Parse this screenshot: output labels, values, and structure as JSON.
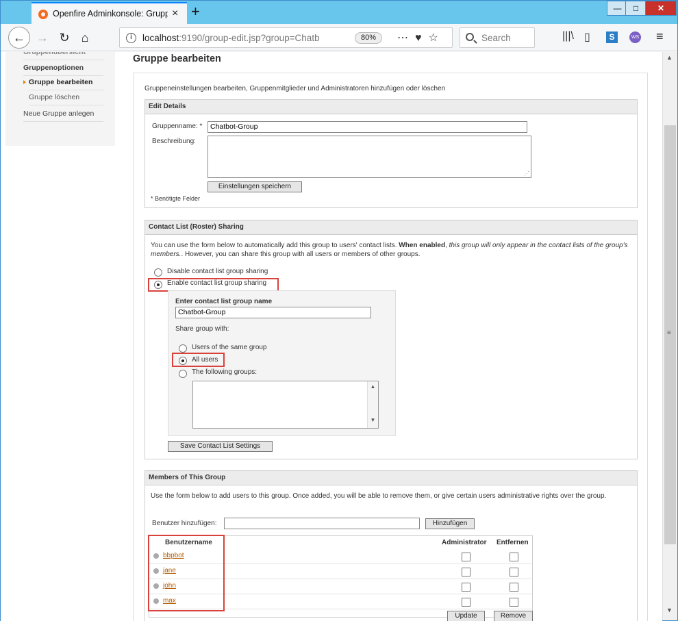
{
  "browser": {
    "tab_title": "Openfire Adminkonsole: Gruppe",
    "tab_close": "×",
    "new_tab": "+",
    "window_minimize": "—",
    "window_maximize": "□",
    "window_close": "✕",
    "url_host": "localhost",
    "url_path": ":9190/group-edit.jsp?group=Chatb",
    "zoom": "80%",
    "search_placeholder": "Search"
  },
  "sidebar": {
    "items": [
      {
        "label": "Gruppenübersicht"
      },
      {
        "label": "Gruppenoptionen"
      },
      {
        "label": "Gruppe bearbeiten"
      },
      {
        "label": "Gruppe löschen"
      },
      {
        "label": "Neue Gruppe anlegen"
      }
    ]
  },
  "page": {
    "title": "Gruppe bearbeiten",
    "description": "Gruppeneinstellungen bearbeiten, Gruppenmitglieder und Administratoren hinzufügen oder löschen"
  },
  "edit_details": {
    "heading": "Edit Details",
    "name_label": "Gruppenname: *",
    "name_value": "Chatbot-Group",
    "desc_label": "Beschreibung:",
    "save_button": "Einstellungen speichern",
    "required_note": "* Benötigte Felder"
  },
  "sharing": {
    "heading": "Contact List (Roster) Sharing",
    "intro_1": "You can use the form below to automatically add this group to users' contact lists. ",
    "intro_bold": "When enabled",
    "intro_2": ", ",
    "intro_italic": "this group will only appear in the contact lists of the group's members.",
    "intro_3": ". However, you can share this group with all users or members of other groups.",
    "option_disable": "Disable contact list group sharing",
    "option_enable": "Enable contact list group sharing",
    "group_name_label": "Enter contact list group name",
    "group_name_value": "Chatbot-Group",
    "share_with_label": "Share group with:",
    "share_same": "Users of the same group",
    "share_all": "All users",
    "share_following": "The following groups:",
    "save_button": "Save Contact List Settings"
  },
  "members": {
    "heading": "Members of This Group",
    "intro": "Use the form below to add users to this group. Once added, you will be able to remove them, or give certain users administrative rights over the group.",
    "add_label": "Benutzer hinzufügen:",
    "add_button": "Hinzufügen",
    "columns": [
      "Benutzername",
      "Administrator",
      "Entfernen"
    ],
    "users": [
      "bbpbot",
      "jane",
      "john",
      "max"
    ],
    "update_button": "Update",
    "remove_button": "Remove"
  }
}
